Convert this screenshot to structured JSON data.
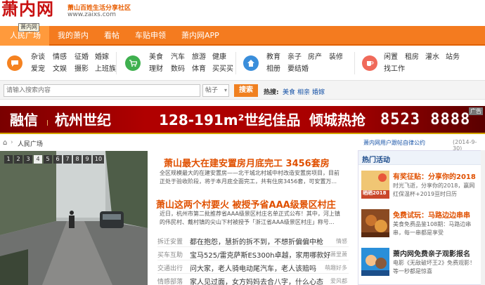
{
  "header": {
    "logo": "萧内网",
    "slogan": "萧山百姓生活分享社区",
    "url": "www.zaixs.com",
    "tooltip": "萧内网"
  },
  "nav": [
    "人民广场",
    "我的萧内",
    "看帖",
    "车贴申领",
    "萧内网APP"
  ],
  "categories": [
    {
      "icon": "speech-bubble-icon",
      "color": "#f58220",
      "rows": [
        [
          "杂谈",
          "情感",
          "征婚",
          "婚嫁"
        ],
        [
          "爱宠",
          "文娱",
          "摄影",
          "上班族"
        ]
      ]
    },
    {
      "icon": "shopping-cart-icon",
      "color": "#3fb04f",
      "rows": [
        [
          "美食",
          "汽车",
          "旅游",
          "健康"
        ],
        [
          "理财",
          "数码",
          "体育",
          "买买买"
        ]
      ]
    },
    {
      "icon": "house-icon",
      "color": "#3a8edb",
      "rows": [
        [
          "教育",
          "亲子",
          "房产",
          "装修"
        ],
        [
          "相册",
          "要结婚"
        ]
      ]
    },
    {
      "icon": "cup-icon",
      "color": "#f06a5a",
      "rows": [
        [
          "闲置",
          "租房",
          "灌水",
          "站务"
        ],
        [
          "找工作"
        ]
      ]
    }
  ],
  "search": {
    "placeholder": "请输入搜索内容",
    "scope": "帖子",
    "button": "搜索",
    "hot_label": "热搜:",
    "hot_words": [
      "美食",
      "相亲",
      "婚嫁"
    ]
  },
  "banner": {
    "brand": "融信",
    "project": "杭州世纪",
    "area": "128-191m²世纪佳品",
    "slogan": "倾城热抢",
    "phone": "8523 8888",
    "ad_tag": "广告"
  },
  "breadcrumb": "人民广场",
  "notice": {
    "text": "萧内网用户跟帖自律公约",
    "date": "(2014-9-30)"
  },
  "slider": [
    "1",
    "2",
    "3",
    "4",
    "5",
    "6",
    "7",
    "8",
    "9",
    "10"
  ],
  "slider_active": 4,
  "headlines": [
    {
      "title": "萧山最大在建安置房月底完工 3456套房",
      "summary": [
        "全区规模最大的在建安置房——北干城北村城中村改造安置房项目，目前",
        "正处于验收阶段，将于本月底全面完工，共有住房3456套，可安置万..."
      ]
    },
    {
      "title": "萧山这两个村要火 被授予省AAA级景区村庄",
      "summary": [
        "近日，杭州市第二批推荐省AAA级景区村庄名单正式公布！其中，河上镇",
        "的伟民村、戴村镇的尖山下村被授予「浙江省AAA级景区村庄」称号..."
      ]
    }
  ],
  "news_rows": [
    {
      "cat": "拆迁安置",
      "text": "都在抱怨，慧折的拆不到，不想折偏偏中枪",
      "tag": "情感"
    },
    {
      "cat": "买车互助",
      "text": "宝马525/雷克萨斯ES300h卓越，家用哪款好",
      "tag": "萧里萧"
    },
    {
      "cat": "交通出行",
      "text": "问大家，老人骑电动尾汽车，老人该赔吗",
      "tag": "萌趣好多"
    },
    {
      "cat": "情感部落",
      "text": "家人见过面，女方妈妈去合八字，什么心态",
      "tag": "爱风都"
    }
  ],
  "sidebar": {
    "title": "热门活动",
    "items": [
      {
        "title": "有奖征贴：分享你的2018",
        "desc": [
          "时光飞逝，分享你的2018，赢网",
          "红保温杯+2019亘时日历"
        ],
        "thumb": "2018-poster-icon",
        "thumb_text": "晒晒2018"
      },
      {
        "title": "免费试玩：马路边边串串",
        "desc": [
          "美食免费品鉴108期：马路边串",
          "串，每一串都是享受"
        ],
        "thumb": "food-photo-icon",
        "thumb_text": ""
      },
      {
        "title": "萧内网免费亲子观影报名",
        "desc": [
          "电影《无敌破坏王2》免费观影！",
          "等一秒都是惊喜"
        ],
        "thumb": "movie-poster-icon",
        "thumb_text": ""
      }
    ]
  },
  "colors": {
    "brand_red": "#c81010",
    "nav_orange": "#f47b1f",
    "headline_orange": "#e05000",
    "link_blue": "#1a55a8"
  }
}
